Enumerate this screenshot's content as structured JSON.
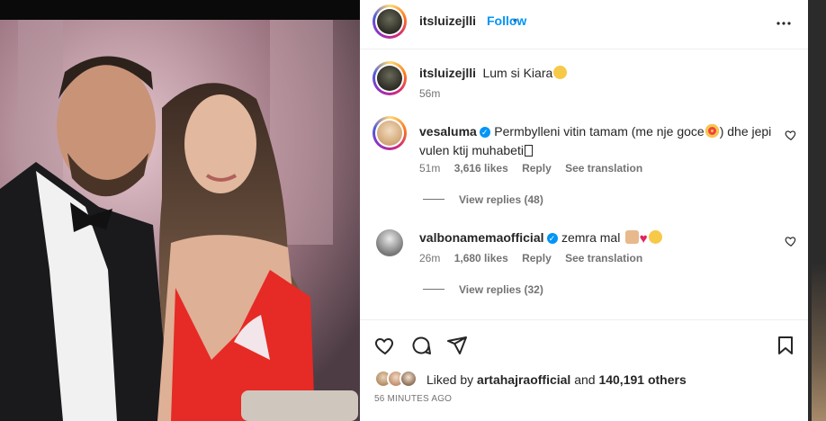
{
  "post": {
    "author": "itsluizejlli",
    "follow_label": "Follow",
    "separator": "•",
    "more_icon": "more-horizontal-icon",
    "caption": {
      "username": "itsluizejlli",
      "text": "Lum si Kiara",
      "time": "56m"
    }
  },
  "comments": [
    {
      "username": "vesaluma",
      "verified": true,
      "text_line1_a": "Permbylleni vitin tamam (me nje goce",
      "text_line1_b": ") dhe jepi",
      "text_line2": "vulen ktij muhabeti",
      "time": "51m",
      "likes": "3,616 likes",
      "reply_label": "Reply",
      "translation_label": "See translation",
      "view_replies": "View replies (48)"
    },
    {
      "username": "valbonamemaofficial",
      "verified": true,
      "text": "zemra mal",
      "time": "26m",
      "likes": "1,680 likes",
      "reply_label": "Reply",
      "translation_label": "See translation",
      "view_replies": "View replies (32)"
    }
  ],
  "footer": {
    "liked_by_prefix": "Liked by",
    "liked_by_user": "artahajraofficial",
    "liked_by_and": "and",
    "liked_by_count": "140,191 others",
    "timestamp": "56 MINUTES AGO"
  },
  "colors": {
    "accent": "#0095f6",
    "text": "#262626",
    "muted": "#737373",
    "like_red": "#ed4956"
  }
}
